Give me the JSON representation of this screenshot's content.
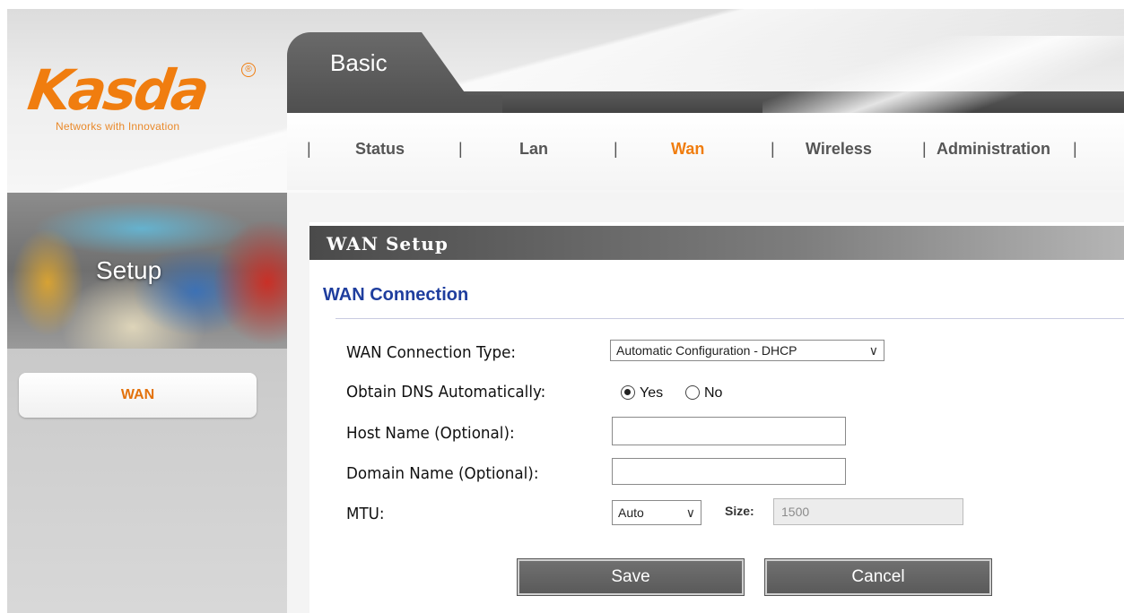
{
  "brand": {
    "logo_text": "Kasda",
    "tagline": "Networks with Innovation",
    "logo_color": "#f07d0f"
  },
  "header": {
    "basic_tab": "Basic"
  },
  "nav": {
    "items": [
      {
        "label": "Status"
      },
      {
        "label": "Lan"
      },
      {
        "label": "Wan",
        "active": true
      },
      {
        "label": "Wireless"
      },
      {
        "label": "Administration"
      }
    ],
    "separator": "|",
    "active_color": "#f07d0f"
  },
  "sidebar": {
    "banner_title": "Setup",
    "items": [
      {
        "label": "WAN",
        "active": true
      }
    ]
  },
  "main": {
    "section_title": "WAN Setup",
    "subsection_title": "WAN Connection",
    "fields": {
      "connection_type": {
        "label": "WAN Connection Type:",
        "value": "Automatic Configuration - DHCP"
      },
      "obtain_dns": {
        "label": "Obtain DNS Automatically:",
        "options": [
          "Yes",
          "No"
        ],
        "selected": "Yes"
      },
      "host_name": {
        "label": "Host Name (Optional):",
        "value": ""
      },
      "domain_name": {
        "label": "Domain Name (Optional):",
        "value": ""
      },
      "mtu": {
        "label": "MTU:",
        "value": "Auto",
        "size_label": "Size:",
        "size_value": "1500"
      }
    },
    "buttons": {
      "save": "Save",
      "cancel": "Cancel"
    }
  }
}
